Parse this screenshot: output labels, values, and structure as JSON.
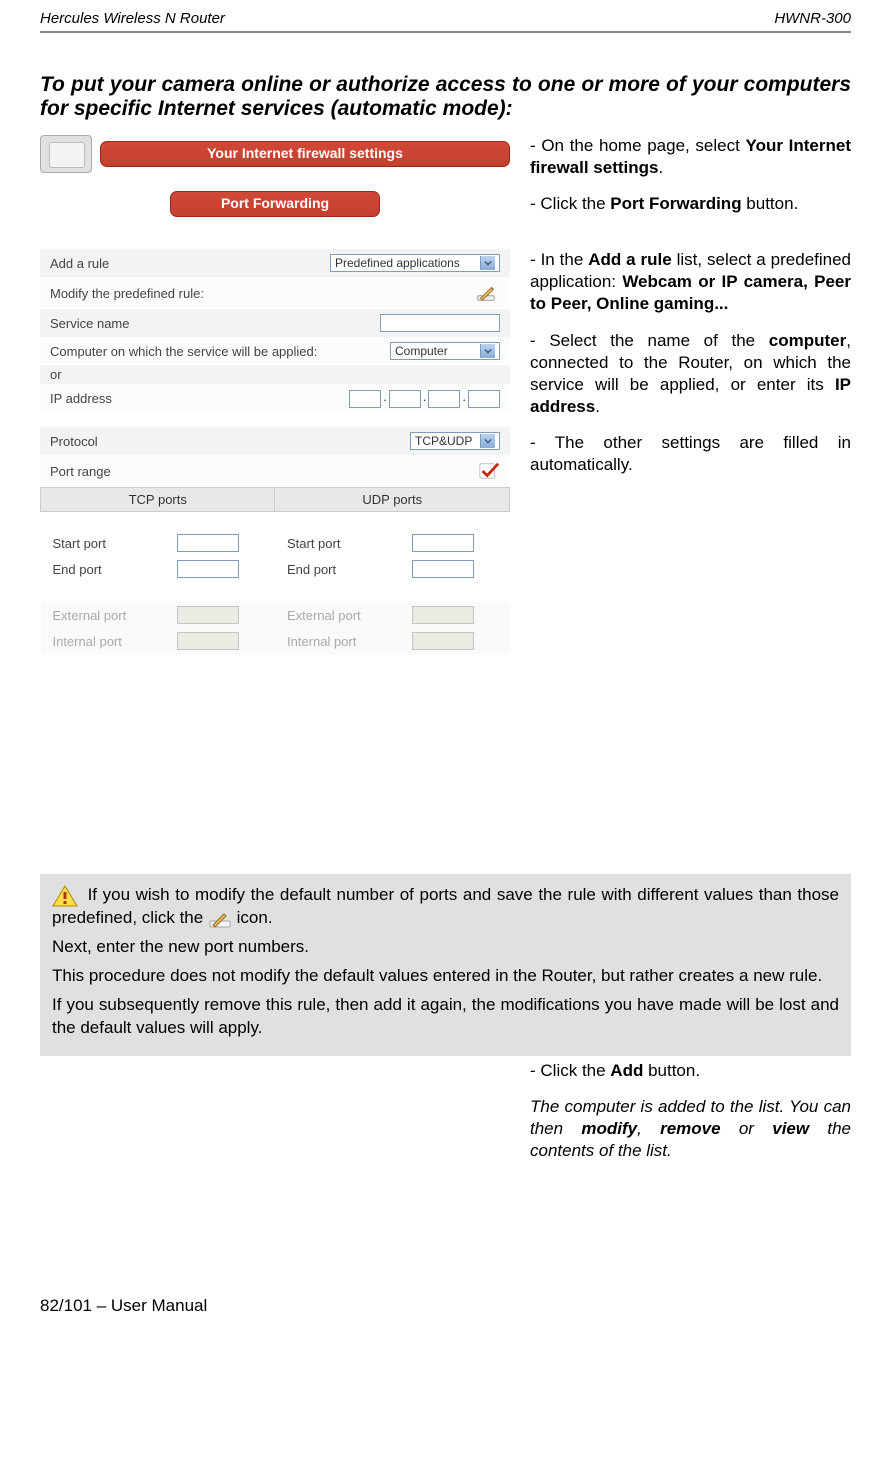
{
  "header": {
    "left": "Hercules Wireless N Router",
    "right": "HWNR-300"
  },
  "section_title": "To put your camera online or authorize access to one or more of your computers for specific Internet services (automatic mode):",
  "nav": {
    "firewall_button": "Your Internet firewall settings",
    "port_forwarding_button": "Port Forwarding"
  },
  "instructions": {
    "p1_a": "- On the home page, select ",
    "p1_b": "Your Internet firewall settings",
    "p1_c": ".",
    "p2_a": "- Click the ",
    "p2_b": "Port Forwarding",
    "p2_c": " button.",
    "p3_a": "- In the ",
    "p3_b": "Add a rule",
    "p3_c": " list, select a predefined application: ",
    "p3_d": "Webcam or IP camera, Peer to Peer, Online gaming...",
    "p4_a": "- Select the name of the ",
    "p4_b": "computer",
    "p4_c": ", connected to the Router, on which the service will be applied, or enter its ",
    "p4_d": "IP address",
    "p4_e": ".",
    "p5": "- The other settings are filled in automatically."
  },
  "form": {
    "add_rule_label": "Add a rule",
    "add_rule_value": "Predefined applications",
    "modify_label": "Modify the predefined rule:",
    "service_name_label": "Service name",
    "service_name_value": "",
    "computer_label": "Computer on which the service will be applied:",
    "computer_value": "Computer",
    "or_label": "or",
    "ip_label": "IP address",
    "protocol_label": "Protocol",
    "protocol_value": "TCP&UDP",
    "port_range_label": "Port range",
    "ports": {
      "tcp_header": "TCP ports",
      "udp_header": "UDP ports",
      "start_port": "Start port",
      "end_port": "End port",
      "external_port": "External port",
      "internal_port": "Internal port"
    }
  },
  "callout": {
    "line1_a": " If you wish to modify the default number of ports and save the rule with different values than those predefined, click the ",
    "line1_b": " icon.",
    "line2": "Next, enter the new port numbers.",
    "line3": "This procedure does not modify the default values entered in the Router, but rather creates a new rule.",
    "line4": "If you subsequently remove this rule, then add it again, the modifications you have made will be lost and the default values will apply."
  },
  "footer_instructions": {
    "p1_a": "- Click the ",
    "p1_b": "Add",
    "p1_c": " button.",
    "p2_a": "The computer is added to the list.  You can then ",
    "p2_b": "modify",
    "p2_c": ", ",
    "p2_d": "remove",
    "p2_e": " or ",
    "p2_f": "view",
    "p2_g": " the contents of the list."
  },
  "footer": "82/101 – User Manual"
}
